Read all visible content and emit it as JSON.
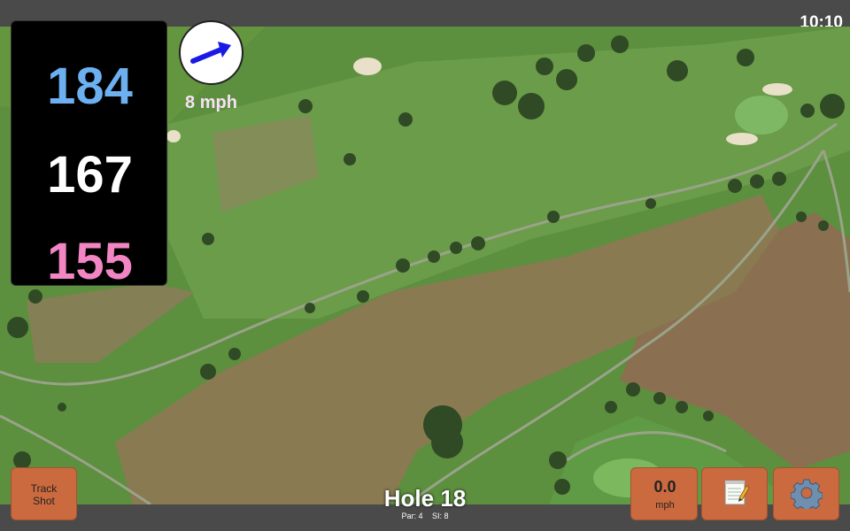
{
  "status": {
    "time": "10:10"
  },
  "distances": {
    "back": "184",
    "middle": "167",
    "front": "155"
  },
  "wind": {
    "speed_label": "8 mph",
    "icon": "wind-arrow-icon",
    "color": "#1a1ae6"
  },
  "hole": {
    "title": "Hole 18",
    "par": "Par: 4",
    "si": "SI: 8"
  },
  "buttons": {
    "track_shot": "Track\nShot",
    "track_line1": "Track",
    "track_line2": "Shot",
    "speed_value": "0.0",
    "speed_unit": "mph",
    "notes_icon": "notepad-icon",
    "settings_icon": "gear-icon"
  },
  "colors": {
    "button_bg": "#cc6a3f",
    "back_distance": "#6cb0f0",
    "middle_distance": "#ffffff",
    "front_distance": "#f286c4",
    "wind_label": "#f8e1f6"
  }
}
